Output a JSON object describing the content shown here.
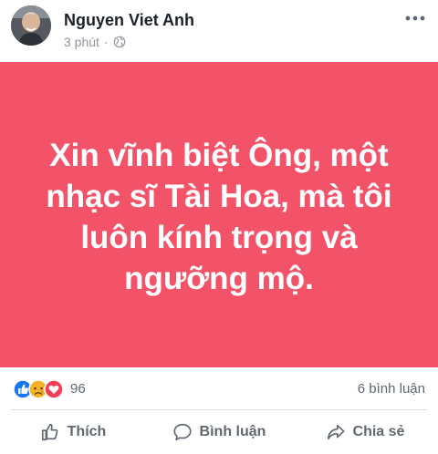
{
  "post": {
    "author_name": "Nguyen Viet Anh",
    "time": "3 phút",
    "privacy_icon": "globe-icon",
    "more_icon": "ellipsis-icon",
    "text": "Xin vĩnh biệt Ông, một nhạc sĩ Tài Hoa, mà tôi luôn kính trọng và ngưỡng mộ.",
    "background_color": "#f35369",
    "text_color": "#ffffff"
  },
  "reactions": {
    "icons": [
      "like-icon",
      "sad-icon",
      "love-icon"
    ],
    "count": "96",
    "comments": "6 bình luận"
  },
  "actions": {
    "like_label": "Thích",
    "comment_label": "Bình luận",
    "share_label": "Chia sẻ"
  },
  "colors": {
    "like_blue": "#1877f2",
    "love_red": "#f33e58",
    "sad_yellow": "#f7b125"
  }
}
